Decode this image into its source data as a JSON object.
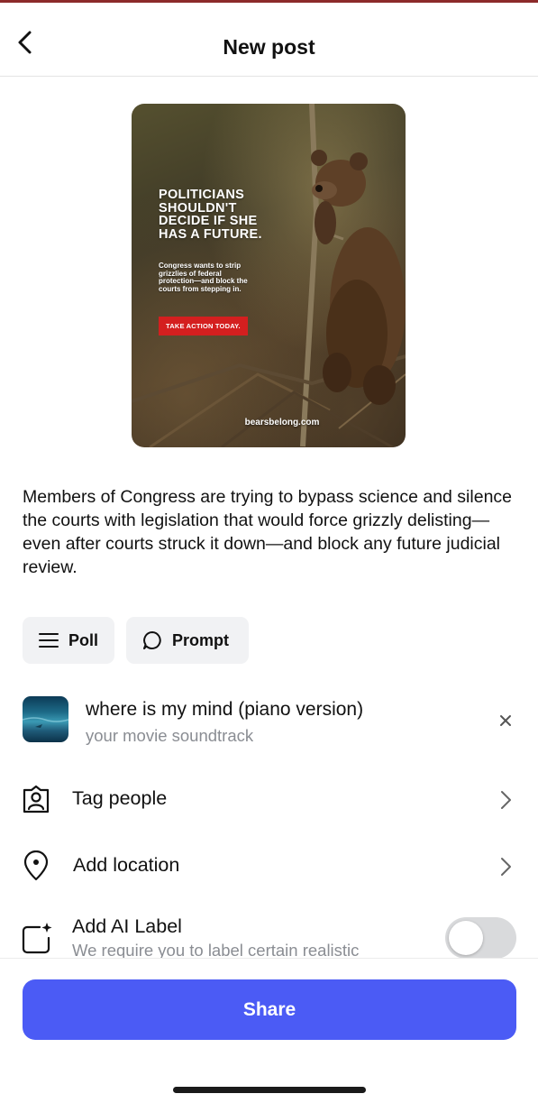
{
  "header": {
    "title": "New post",
    "back_icon": "chevron-left-icon"
  },
  "post_image": {
    "headline": "POLITICIANS\nSHOULDN'T\nDECIDE IF SHE\nHAS A FUTURE.",
    "subtext": "Congress wants to strip\ngrizzlies of federal\nprotection—and block the\ncourts from stepping in.",
    "cta": "TAKE ACTION TODAY.",
    "domain": "bearsbelong.com"
  },
  "caption": "Members of Congress are trying to bypass science and silence the courts with legislation that  would force grizzly delisting—even after courts struck it down—and block any future judicial review.",
  "chips": {
    "poll": {
      "label": "Poll",
      "icon": "list-icon"
    },
    "prompt": {
      "label": "Prompt",
      "icon": "speech-bubble-icon"
    }
  },
  "music": {
    "title": "where is my mind (piano version)",
    "artist": "your movie soundtrack",
    "remove_icon": "close-icon"
  },
  "options": {
    "tag_people": {
      "label": "Tag people",
      "icon": "person-tag-icon"
    },
    "add_location": {
      "label": "Add location",
      "icon": "location-pin-icon"
    },
    "ai_label": {
      "label": "Add AI Label",
      "description": "We require you to label certain realistic",
      "icon": "ai-sparkle-icon",
      "enabled": false
    }
  },
  "share_label": "Share",
  "colors": {
    "primary": "#4b5bf5",
    "toggle_off": "#d9dadc",
    "cta_red": "#d41f1f"
  }
}
